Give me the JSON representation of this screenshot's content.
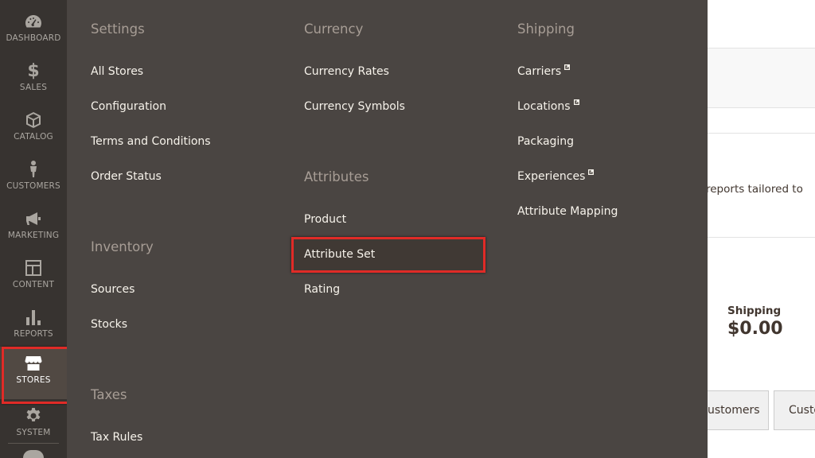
{
  "nav": {
    "items": [
      {
        "label": "DASHBOARD",
        "icon": "dashboard-icon"
      },
      {
        "label": "$",
        "icon": "dollar-icon"
      },
      {
        "label": "SALES",
        "icon": "sales-icon"
      },
      {
        "label": "CATALOG",
        "icon": "catalog-box-icon"
      },
      {
        "label": "CUSTOMERS",
        "icon": "customer-person-icon"
      },
      {
        "label": "MARKETING",
        "icon": "megaphone-icon"
      },
      {
        "label": "CONTENT",
        "icon": "layout-icon"
      },
      {
        "label": "REPORTS",
        "icon": "bar-chart-icon"
      },
      {
        "label": "STORES",
        "icon": "storefront-icon"
      },
      {
        "label": "SYSTEM",
        "icon": "gear-icon"
      }
    ],
    "active": "STORES",
    "highlight_color": "#e02b27"
  },
  "flyout": {
    "settings": {
      "title": "Settings",
      "links": [
        "All Stores",
        "Configuration",
        "Terms and Conditions",
        "Order Status"
      ]
    },
    "inventory": {
      "title": "Inventory",
      "links": [
        "Sources",
        "Stocks"
      ]
    },
    "taxes": {
      "title": "Taxes",
      "links": [
        "Tax Rules"
      ]
    },
    "currency": {
      "title": "Currency",
      "links": [
        "Currency Rates",
        "Currency Symbols"
      ]
    },
    "attributes": {
      "title": "Attributes",
      "links": [
        "Product",
        "Attribute Set",
        "Rating"
      ]
    },
    "shipping": {
      "title": "Shipping",
      "links": [
        "Carriers",
        "Locations",
        "Packaging",
        "Experiences",
        "Attribute Mapping"
      ]
    },
    "highlighted_link": "Attribute Set"
  },
  "background": {
    "partial_text": "reports tailored to",
    "shipping_label": "Shipping",
    "shipping_value": "$0.00",
    "tabs": [
      "ustomers",
      "Custo"
    ]
  },
  "colors": {
    "nav_bg": "#373330",
    "flyout_bg": "#4a4542",
    "section_title": "#a79d95",
    "link": "#f7f3eb"
  }
}
